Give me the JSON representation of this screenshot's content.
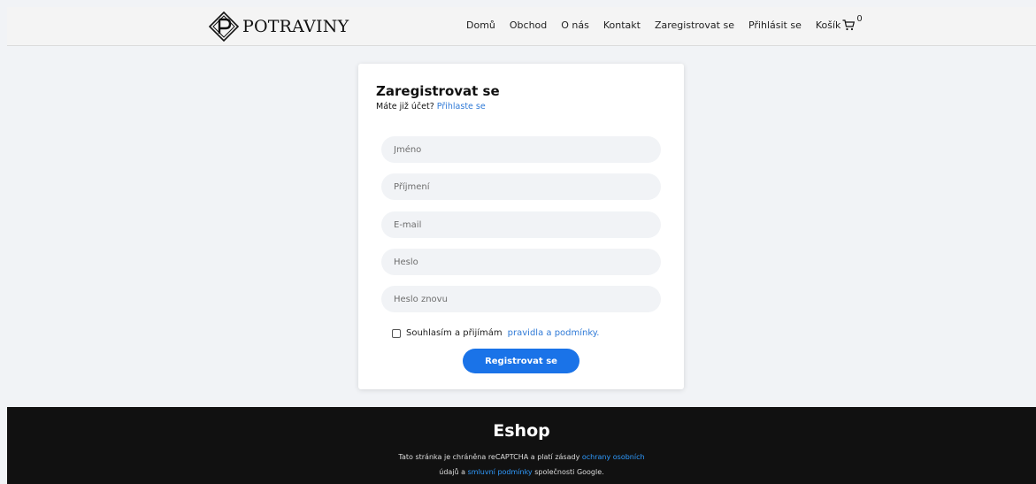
{
  "header": {
    "brand": "POTRAVINY",
    "nav": [
      "Domů",
      "Obchod",
      "O nás",
      "Kontakt",
      "Zaregistrovat se",
      "Přihlásit se"
    ],
    "cart_label": "Košík",
    "cart_count": "0"
  },
  "form": {
    "title": "Zaregistrovat se",
    "subtitle_text": "Máte již účet?",
    "login_link": "Přihlaste se",
    "fields": {
      "first_name": "Jméno",
      "last_name": "Příjmení",
      "email": "E-mail",
      "password": "Heslo",
      "password_again": "Heslo znovu"
    },
    "consent_text": "Souhlasím a přijímám",
    "consent_link": "pravidla a podmínky.",
    "submit_label": "Registrovat se"
  },
  "footer": {
    "title": "Eshop",
    "line1_text": "Tato stránka je chráněna reCAPTCHA a platí zásady",
    "line1_link": "ochrany osobních",
    "line2_prefix": "údajů a",
    "line2_link": "smluvní podmínky",
    "line2_suffix": "společnosti Google."
  },
  "colors": {
    "accent": "#1a73e8",
    "link": "#2f7ad7",
    "footer_bg": "#111111",
    "page_bg": "#f1f3f6"
  }
}
